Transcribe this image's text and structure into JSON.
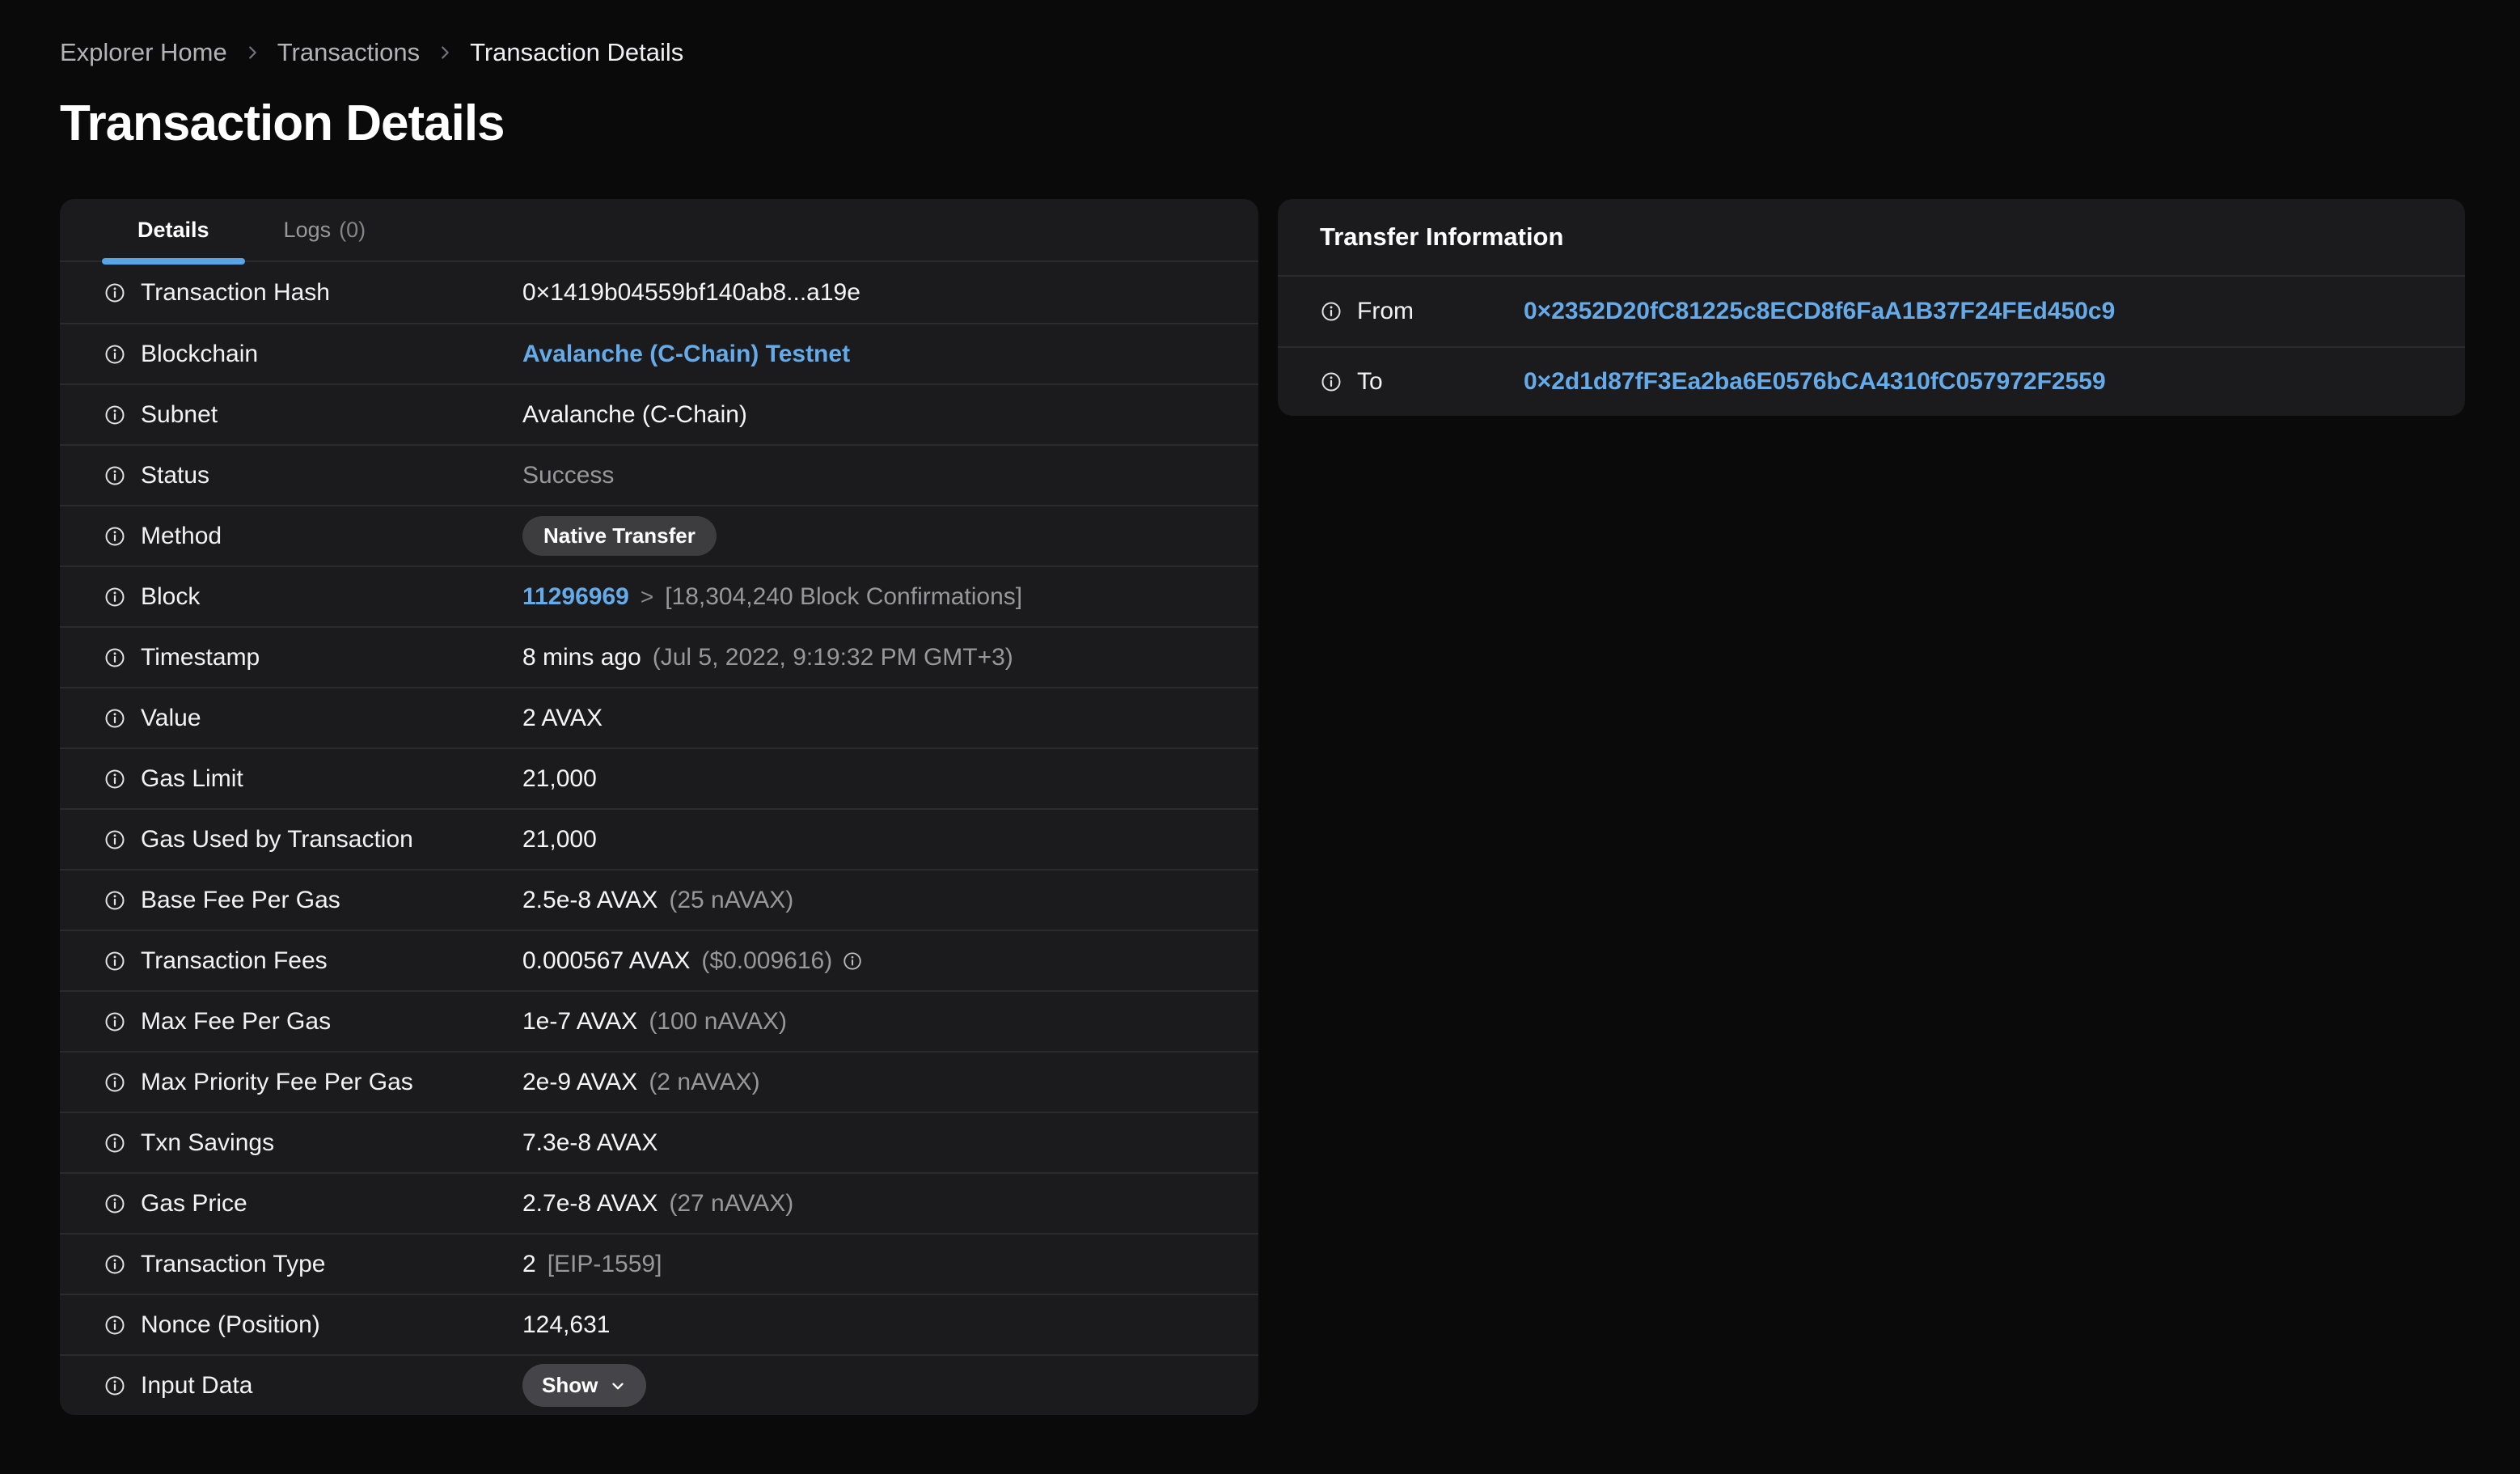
{
  "colors": {
    "page_bg": "#0a0a0b",
    "card_bg": "#1b1b1d",
    "divider": "#2e2e31",
    "text_primary": "#f5f5f6",
    "text_muted": "#97979c",
    "breadcrumb_link": "#b3b3b7",
    "accent_blue": "#55a5e8",
    "link_blue": "#66abe9",
    "badge_bg": "#3d3d40",
    "button_bg": "#454549"
  },
  "breadcrumb": {
    "items": [
      "Explorer Home",
      "Transactions",
      "Transaction Details"
    ]
  },
  "page_title": "Transaction Details",
  "details_card": {
    "tabs": {
      "details": "Details",
      "logs": "Logs",
      "logs_count": "(0)"
    },
    "rows": {
      "transaction_hash": {
        "label": "Transaction Hash",
        "value": "0×1419b04559bf140ab8...a19e"
      },
      "blockchain": {
        "label": "Blockchain",
        "value": "Avalanche (C-Chain) Testnet"
      },
      "subnet": {
        "label": "Subnet",
        "value": "Avalanche (C-Chain)"
      },
      "status": {
        "label": "Status",
        "value": "Success"
      },
      "method": {
        "label": "Method",
        "value": "Native Transfer"
      },
      "block": {
        "label": "Block",
        "value": "11296969",
        "separator": ">",
        "confirmations": "[18,304,240 Block Confirmations]"
      },
      "timestamp": {
        "label": "Timestamp",
        "value": "8 mins ago",
        "detail": "(Jul 5, 2022, 9:19:32 PM GMT+3)"
      },
      "value": {
        "label": "Value",
        "value": "2 AVAX"
      },
      "gas_limit": {
        "label": "Gas Limit",
        "value": "21,000"
      },
      "gas_used": {
        "label": "Gas Used by Transaction",
        "value": "21,000"
      },
      "base_fee": {
        "label": "Base Fee Per Gas",
        "value": "2.5e-8 AVAX",
        "detail": "(25 nAVAX)"
      },
      "transaction_fees": {
        "label": "Transaction Fees",
        "value": "0.000567 AVAX",
        "detail": "($0.009616)"
      },
      "max_fee": {
        "label": "Max Fee Per Gas",
        "value": "1e-7 AVAX",
        "detail": "(100 nAVAX)"
      },
      "max_priority_fee": {
        "label": "Max Priority Fee Per Gas",
        "value": "2e-9 AVAX",
        "detail": "(2 nAVAX)"
      },
      "txn_savings": {
        "label": "Txn Savings",
        "value": "7.3e-8 AVAX"
      },
      "gas_price": {
        "label": "Gas Price",
        "value": "2.7e-8 AVAX",
        "detail": "(27 nAVAX)"
      },
      "transaction_type": {
        "label": "Transaction Type",
        "value": "2",
        "detail": "[EIP-1559]"
      },
      "nonce": {
        "label": "Nonce (Position)",
        "value": "124,631"
      },
      "input_data": {
        "label": "Input Data",
        "button_label": "Show"
      }
    }
  },
  "transfer_card": {
    "title": "Transfer Information",
    "from": {
      "label": "From",
      "value": "0×2352D20fC81225c8ECD8f6FaA1B37F24FEd450c9"
    },
    "to": {
      "label": "To",
      "value": "0×2d1d87fF3Ea2ba6E0576bCA4310fC057972F2559"
    }
  }
}
